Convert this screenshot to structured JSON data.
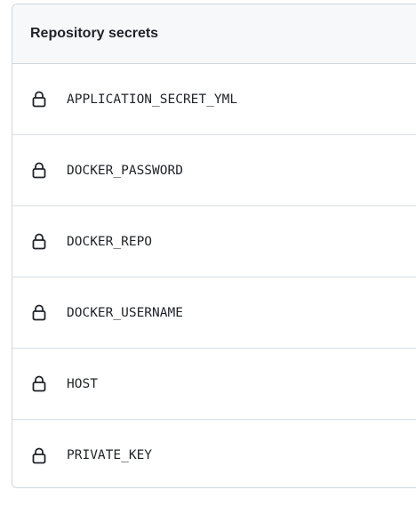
{
  "header": {
    "title": "Repository secrets"
  },
  "secrets": [
    {
      "name": "APPLICATION_SECRET_YML",
      "icon": "lock-icon"
    },
    {
      "name": "DOCKER_PASSWORD",
      "icon": "lock-icon"
    },
    {
      "name": "DOCKER_REPO",
      "icon": "lock-icon"
    },
    {
      "name": "DOCKER_USERNAME",
      "icon": "lock-icon"
    },
    {
      "name": "HOST",
      "icon": "lock-icon"
    },
    {
      "name": "PRIVATE_KEY",
      "icon": "lock-icon"
    }
  ],
  "colors": {
    "border": "#d0d7de",
    "header_bg": "#f6f8fa",
    "text": "#1f2328"
  }
}
